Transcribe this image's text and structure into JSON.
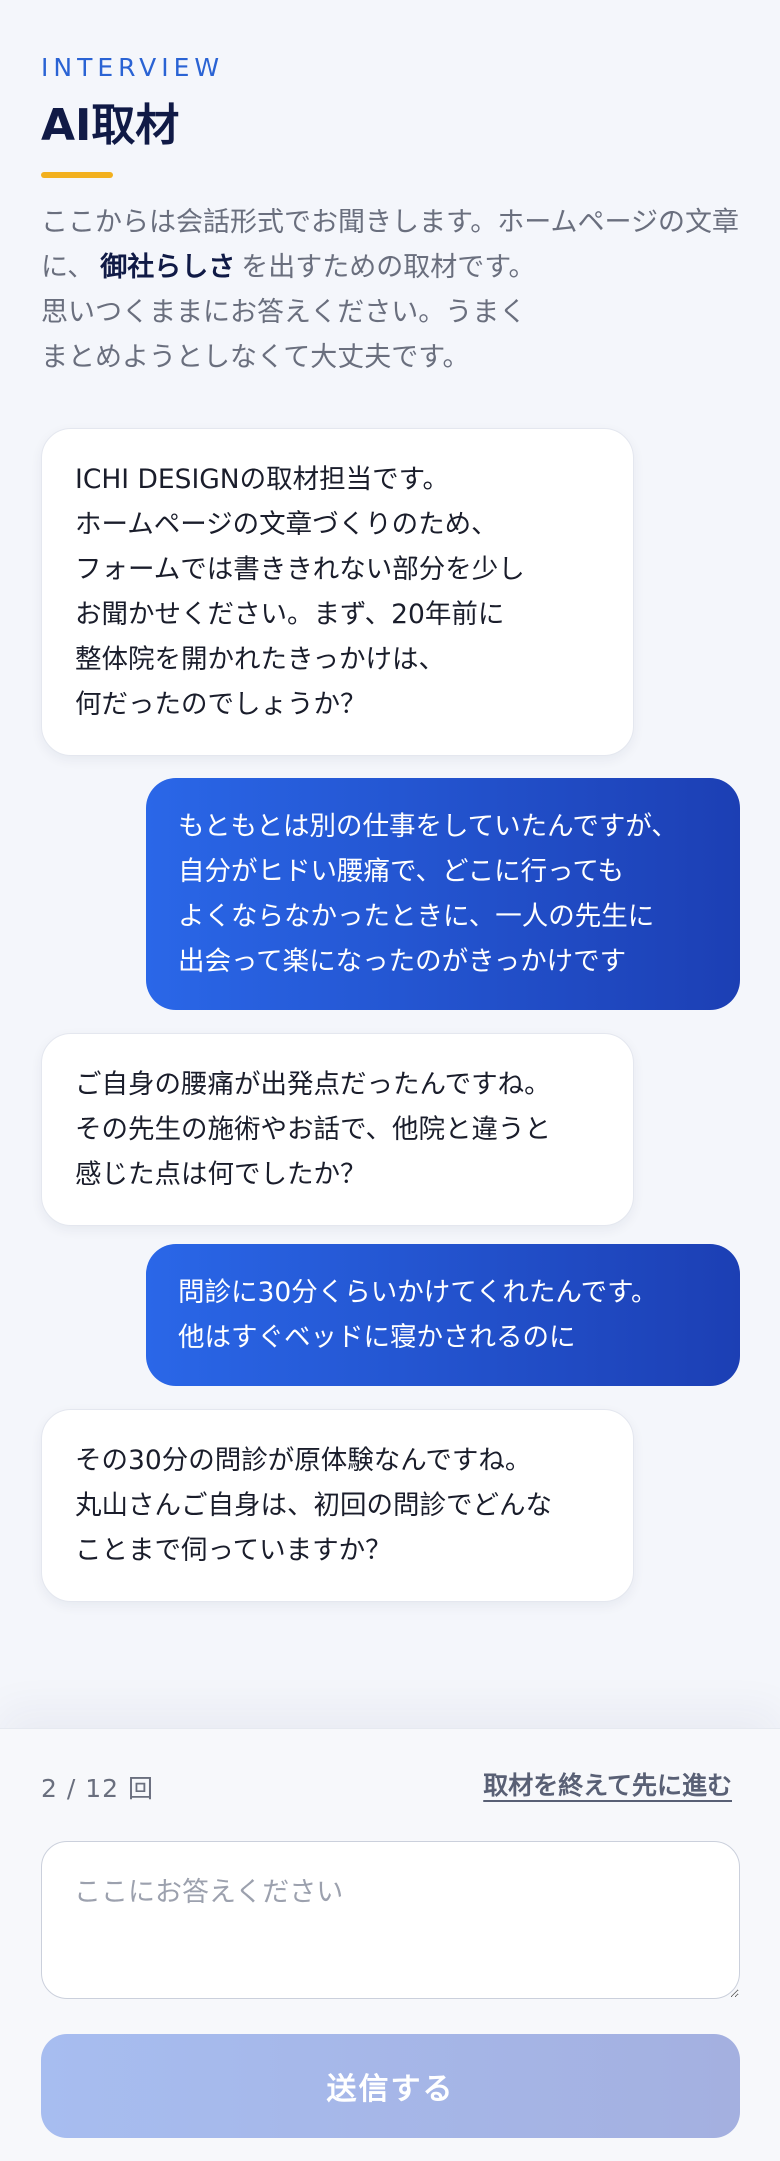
{
  "header": {
    "eyebrow": "INTERVIEW",
    "title": "AI取材",
    "intro_before": "ここからは会話形式でお聞きします。ホームページの文章に、",
    "intro_emphasis": "御社らしさ",
    "intro_after": "を出すための取材です。\n思いつくままにお答えください。うまく\nまとめようとしなくて大丈夫です。"
  },
  "messages": [
    {
      "role": "ai",
      "text": "ICHI DESIGNの取材担当です。\nホームページの文章づくりのため、\nフォームでは書ききれない部分を少し\nお聞かせください。まず、20年前に\n整体院を開かれたきっかけは、\n何だったのでしょうか？"
    },
    {
      "role": "user",
      "text": "もともとは別の仕事をしていたんですが、\n自分がヒドい腰痛で、どこに行っても\nよくならなかったときに、一人の先生に\n出会って楽になったのがきっかけです"
    },
    {
      "role": "ai",
      "text": "ご自身の腰痛が出発点だったんですね。\nその先生の施術やお話で、他院と違うと\n感じた点は何でしたか？"
    },
    {
      "role": "user",
      "text": "問診に30分くらいかけてくれたんです。\n他はすぐベッドに寝かされるのに"
    },
    {
      "role": "ai",
      "text": "その30分の問診が原体験なんですね。\n丸山さんご自身は、初回の問診でどんな\nことまで伺っていますか？"
    }
  ],
  "footer": {
    "counter": "2 / 12 回",
    "finish_link": "取材を終えて先に進む",
    "input_placeholder": "ここにお答えください",
    "input_value": "",
    "send_label": "送信する"
  },
  "colors": {
    "accent_blue": "#2a63d4",
    "accent_yellow": "#f2b01e",
    "user_bubble_start": "#2a67e8",
    "user_bubble_end": "#1c3fb4",
    "send_button_disabled": "#a7bdf0"
  }
}
